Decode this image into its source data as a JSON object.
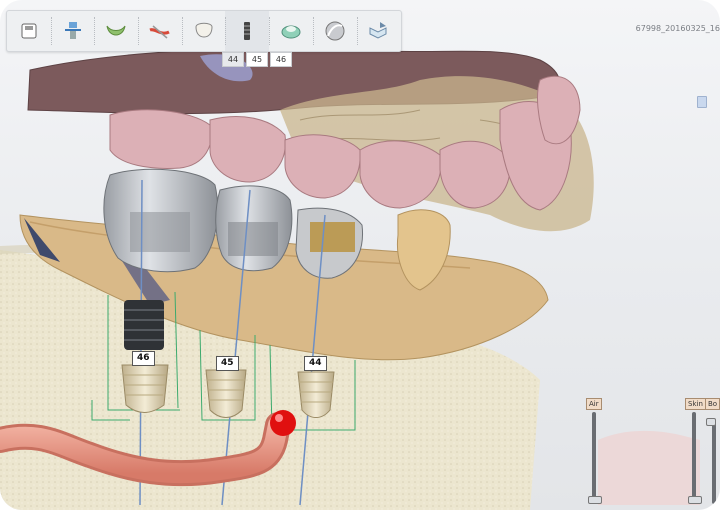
{
  "toolbar": {
    "tools": [
      {
        "name": "save-icon"
      },
      {
        "name": "implant-planning-icon"
      },
      {
        "name": "lower-jaw-icon"
      },
      {
        "name": "nerve-tracing-icon"
      },
      {
        "name": "tooth-crown-icon"
      },
      {
        "name": "implant-icon"
      },
      {
        "name": "guide-sleeve-icon"
      },
      {
        "name": "sphere-view-icon"
      },
      {
        "name": "export-icon"
      }
    ],
    "subtabs": [
      "44",
      "45",
      "46"
    ],
    "selected_subtab": "44"
  },
  "file_name": "67998_20160325_16",
  "implants": [
    {
      "label": "46"
    },
    {
      "label": "45"
    },
    {
      "label": "44"
    }
  ],
  "sliders": {
    "left_label": "Air",
    "right_labels": [
      "Skin",
      "Bo"
    ]
  },
  "colors": {
    "gingiva": "#d9aeb4",
    "bone": "#efe9d2",
    "soft_tissue_scan": "#d9b988",
    "nerve_canal": "#e8917e",
    "alert_marker": "#e01010",
    "guide_lines": "#2ea86a"
  }
}
